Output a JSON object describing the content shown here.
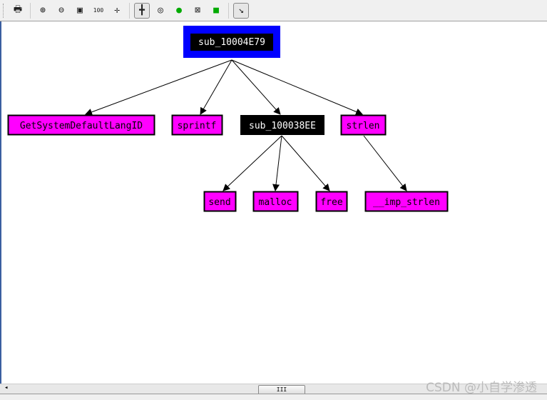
{
  "toolbar": {
    "buttons": [
      {
        "name": "print-icon",
        "glyph": "🖶"
      },
      {
        "name": "zoom-in-icon",
        "glyph": "⊕"
      },
      {
        "name": "zoom-out-icon",
        "glyph": "⊖"
      },
      {
        "name": "fit-window-icon",
        "glyph": "▣"
      },
      {
        "name": "zoom-100-icon",
        "glyph": "100"
      },
      {
        "name": "center-icon",
        "glyph": "✛"
      },
      {
        "name": "layout-icon",
        "glyph": "╋"
      },
      {
        "name": "node-icon",
        "glyph": "◎"
      },
      {
        "name": "green-node-icon",
        "glyph": "●"
      },
      {
        "name": "edge-node-icon",
        "glyph": "⊠"
      },
      {
        "name": "green-edge-icon",
        "glyph": "■"
      },
      {
        "name": "arrow-icon",
        "glyph": "↘"
      }
    ]
  },
  "graph": {
    "root": "sub_10004E79",
    "nodes": [
      "GetSystemDefaultLangID",
      "sprintf",
      "sub_100038EE",
      "strlen",
      "send",
      "malloc",
      "free",
      "__imp_strlen"
    ],
    "colors": {
      "root_frame": "#0000ff",
      "imported": "#ff00ff",
      "local": "#000000"
    }
  },
  "scrollbar": {
    "thumb_label": "III"
  },
  "watermark": "CSDN @小自学渗透"
}
